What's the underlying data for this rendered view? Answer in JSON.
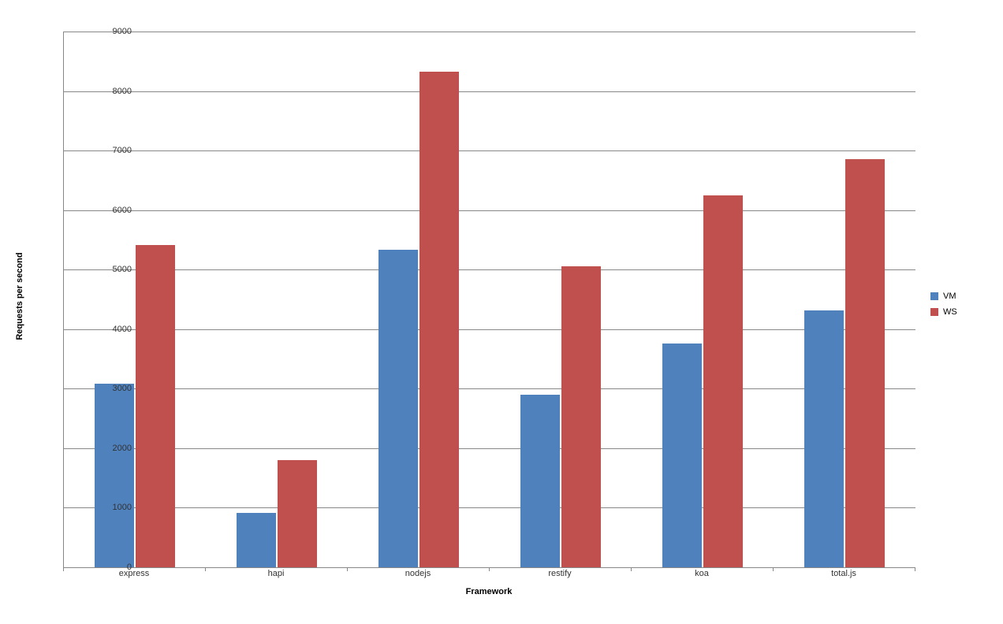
{
  "chart_data": {
    "type": "bar",
    "categories": [
      "express",
      "hapi",
      "nodejs",
      "restify",
      "koa",
      "total.js"
    ],
    "series": [
      {
        "name": "VM",
        "values": [
          3080,
          920,
          5330,
          2900,
          3760,
          4310
        ],
        "color": "#4f81bd"
      },
      {
        "name": "WS",
        "values": [
          5410,
          1800,
          8320,
          5060,
          6250,
          6850
        ],
        "color": "#c0504d"
      }
    ],
    "xlabel": "Framework",
    "ylabel": "Requests per second",
    "ylim": [
      0,
      9000
    ],
    "ystep": 1000,
    "title": "",
    "grid": true,
    "legend_position": "right"
  },
  "y_ticks": [
    "0",
    "1000",
    "2000",
    "3000",
    "4000",
    "5000",
    "6000",
    "7000",
    "8000",
    "9000"
  ],
  "legend": {
    "vm": "VM",
    "ws": "WS"
  }
}
